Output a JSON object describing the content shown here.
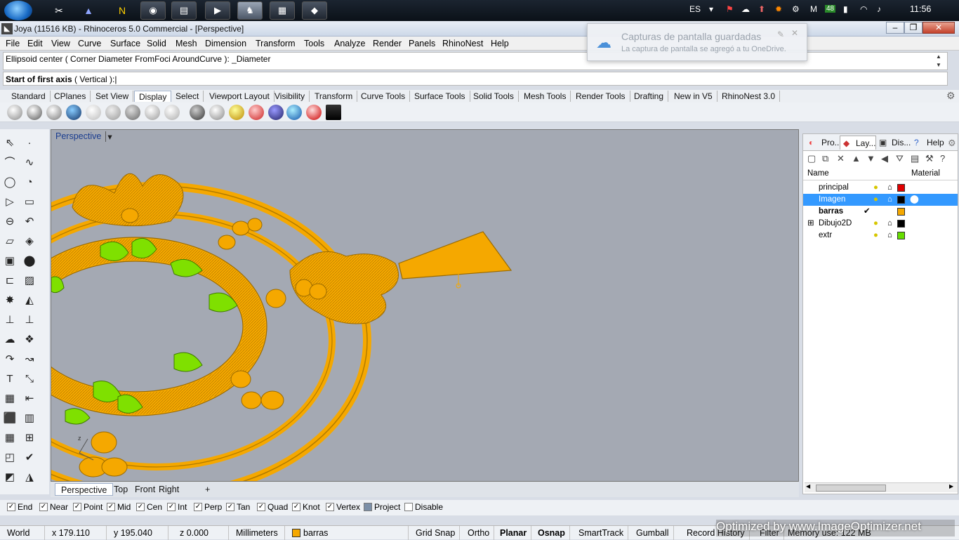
{
  "taskbar": {
    "language": "ES",
    "clock": "11:56",
    "tray_badge": "48",
    "tray_m": "M"
  },
  "title": "Joya (11516 KB) - Rhinoceros 5.0 Commercial - [Perspective]",
  "menu": [
    "File",
    "Edit",
    "View",
    "Curve",
    "Surface",
    "Solid",
    "Mesh",
    "Dimension",
    "Transform",
    "Tools",
    "Analyze",
    "Render",
    "Panels",
    "RhinoNest",
    "Help"
  ],
  "command": {
    "history": "Ellipsoid center ( Corner  Diameter  FromFoci  AroundCurve ): _Diameter",
    "prompt_bold": "Start of first axis",
    "prompt_rest": " ( Vertical ):"
  },
  "toolbar_tabs": [
    "Standard",
    "CPlanes",
    "Set View",
    "Display",
    "Select",
    "Viewport Layout",
    "Visibility",
    "Transform",
    "Curve Tools",
    "Surface Tools",
    "Solid Tools",
    "Mesh Tools",
    "Render Tools",
    "Drafting",
    "New in V5",
    "RhinoNest 3.0"
  ],
  "active_toolbar_tab": "Display",
  "viewport": {
    "label": "Perspective",
    "background": "#a4a9b3",
    "object_color": "#f5a800",
    "highlight_color": "#7fe000"
  },
  "viewport_tabs": [
    "Perspective",
    "Top",
    "Front",
    "Right"
  ],
  "osnaps": [
    {
      "label": "End",
      "checked": true
    },
    {
      "label": "Near",
      "checked": true
    },
    {
      "label": "Point",
      "checked": true
    },
    {
      "label": "Mid",
      "checked": true
    },
    {
      "label": "Cen",
      "checked": true
    },
    {
      "label": "Int",
      "checked": true
    },
    {
      "label": "Perp",
      "checked": true
    },
    {
      "label": "Tan",
      "checked": true
    },
    {
      "label": "Quad",
      "checked": true
    },
    {
      "label": "Knot",
      "checked": true
    },
    {
      "label": "Vertex",
      "checked": true
    },
    {
      "label": "Project",
      "checked": false
    },
    {
      "label": "Disable",
      "checked": false
    }
  ],
  "status": {
    "cplane": "World",
    "x": "x 179.110",
    "y": "y 195.040",
    "z": "z 0.000",
    "units": "Millimeters",
    "layer": "barras",
    "grid_snap": "Grid Snap",
    "ortho": "Ortho",
    "planar": "Planar",
    "osnap": "Osnap",
    "smarttrack": "SmartTrack",
    "gumball": "Gumball",
    "record_history": "Record History",
    "filter": "Filter",
    "memory": "Memory use: 122 MB"
  },
  "panel": {
    "tabs": [
      "Pro...",
      "Lay...",
      "Dis...",
      "Help"
    ],
    "columns": {
      "name": "Name",
      "material": "Material"
    },
    "layers": [
      {
        "name": "principal",
        "color": "#e00000",
        "current": false,
        "selected": false
      },
      {
        "name": "Imagen",
        "color": "#000000",
        "current": false,
        "selected": true
      },
      {
        "name": "barras",
        "color": "#f5a800",
        "current": true,
        "selected": false
      },
      {
        "name": "Dibujo2D",
        "color": "#000000",
        "current": false,
        "selected": false
      },
      {
        "name": "extr",
        "color": "#66dd00",
        "current": false,
        "selected": false
      }
    ]
  },
  "notification": {
    "title": "Capturas de pantalla guardadas",
    "body": "La captura de pantalla se agregó a tu OneDrive."
  },
  "watermark": "Optimized by www.ImageOptimizer.net"
}
